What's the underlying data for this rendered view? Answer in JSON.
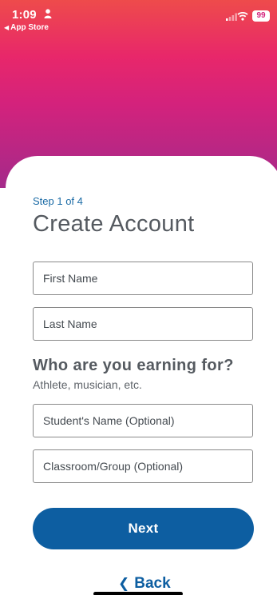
{
  "status_bar": {
    "time": "1:09",
    "back_app_label": "App Store",
    "battery": "99"
  },
  "form": {
    "step_label": "Step 1 of 4",
    "title": "Create Account",
    "first_name_placeholder": "First Name",
    "last_name_placeholder": "Last Name",
    "earning_heading": "Who are you earning for?",
    "earning_subtext": "Athlete, musician, etc.",
    "student_name_placeholder": "Student's Name (Optional)",
    "classroom_placeholder": "Classroom/Group (Optional)",
    "next_label": "Next",
    "back_label": "Back"
  },
  "icons": {
    "person": "person-icon",
    "signal": "signal-icon",
    "wifi": "wifi-icon",
    "back_chevron": "chevron-left-icon"
  },
  "colors": {
    "accent_blue": "#0d5ea1",
    "step_blue": "#1a6aa5",
    "gradient_top": "#ee4b4b",
    "gradient_bottom": "#a42a8a"
  }
}
